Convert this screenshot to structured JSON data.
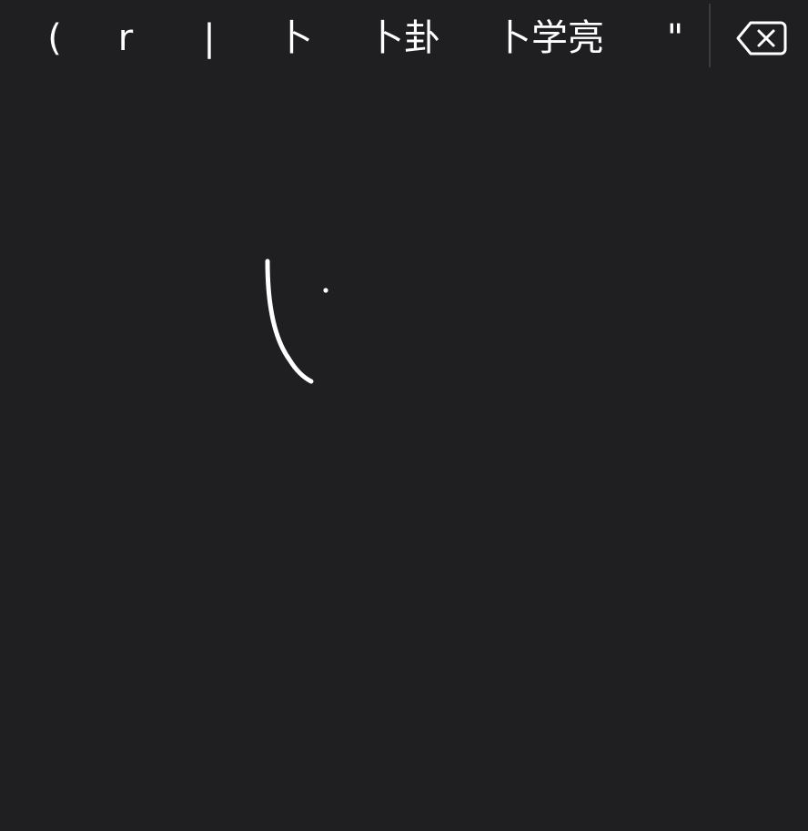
{
  "candidates": [
    "(",
    "r",
    "|",
    "卜",
    "卜卦",
    "卜学亮",
    "\""
  ],
  "delete_icon": "delete-backspace-icon",
  "colors": {
    "background": "#1f1e21",
    "text": "#ffffff",
    "stroke": "#ffffff",
    "divider": "#3b3a3e"
  }
}
